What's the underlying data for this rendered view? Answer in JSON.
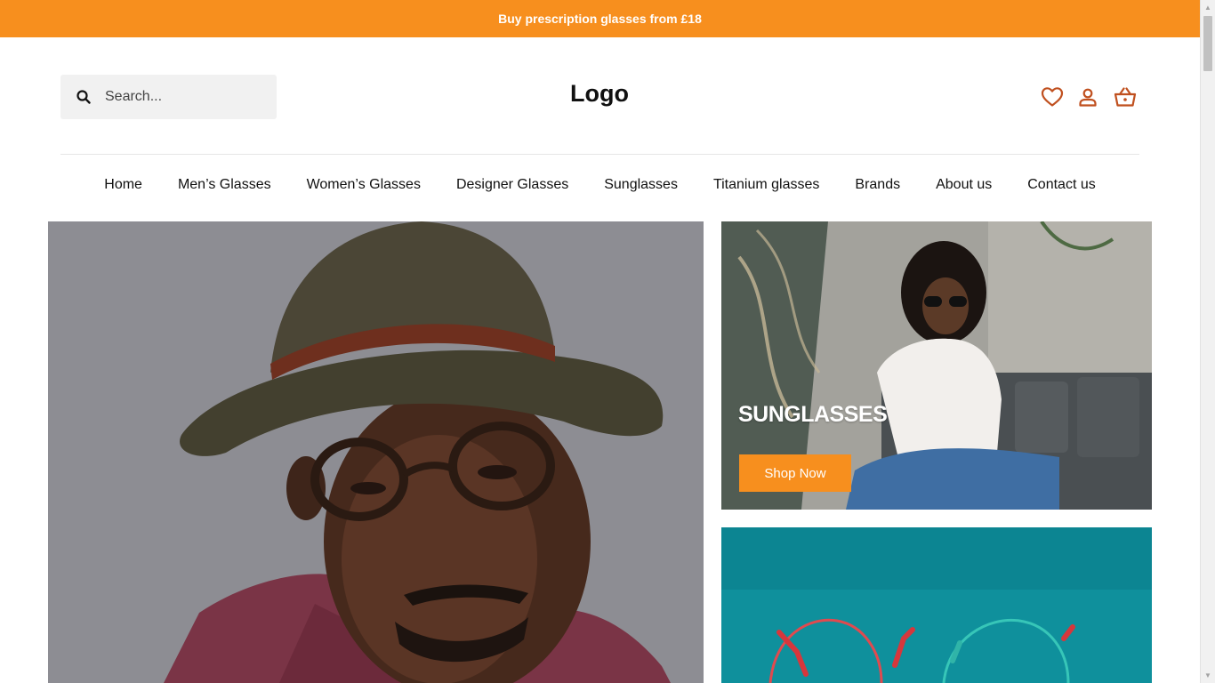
{
  "announcement": {
    "text": "Buy prescription glasses from £18"
  },
  "search": {
    "placeholder": "Search..."
  },
  "header": {
    "logo": "Logo"
  },
  "nav": {
    "items": [
      "Home",
      "Men’s Glasses",
      "Women’s Glasses",
      "Designer Glasses",
      "Sunglasses",
      "Titanium glasses",
      "Brands",
      "About us",
      "Contact us"
    ]
  },
  "promo": {
    "sunglasses": {
      "title": "SUNGLASSES",
      "button": "Shop Now"
    }
  },
  "icons": {
    "search": "search-icon",
    "wishlist": "heart-icon",
    "account": "user-icon",
    "cart": "basket-icon"
  },
  "colors": {
    "accent": "#f78f1e",
    "icon": "#c0501f"
  }
}
